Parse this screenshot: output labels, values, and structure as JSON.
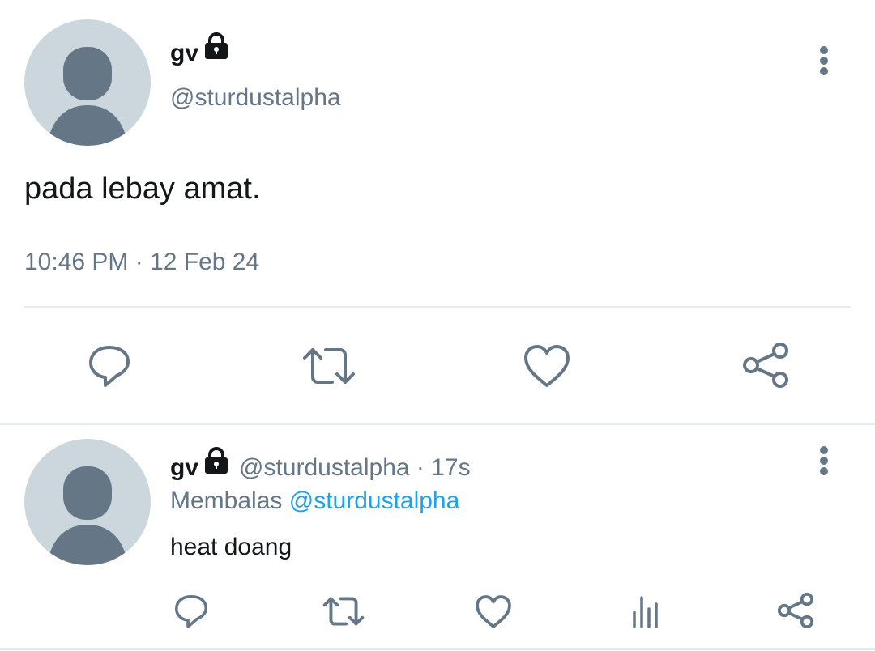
{
  "main_tweet": {
    "display_name": "gv",
    "handle": "@sturdustalpha",
    "text": "pada lebay amat.",
    "timestamp": "10:46 PM · 12 Feb 24",
    "actions": [
      "reply-icon",
      "retweet-icon",
      "like-icon",
      "share-icon"
    ]
  },
  "reply_tweet": {
    "display_name": "gv",
    "handle_time": "@sturdustalpha · 17s",
    "replying_label": "Membalas",
    "replying_to": "@sturdustalpha",
    "text": "heat doang",
    "actions": [
      "reply-icon",
      "retweet-icon",
      "like-icon",
      "analytics-icon",
      "share-icon"
    ]
  },
  "colors": {
    "secondary_text": "#657786",
    "link": "#1da1f2",
    "avatar_bg": "#ccd6dd",
    "avatar_fg": "#657786",
    "divider": "#e6ecf0"
  }
}
